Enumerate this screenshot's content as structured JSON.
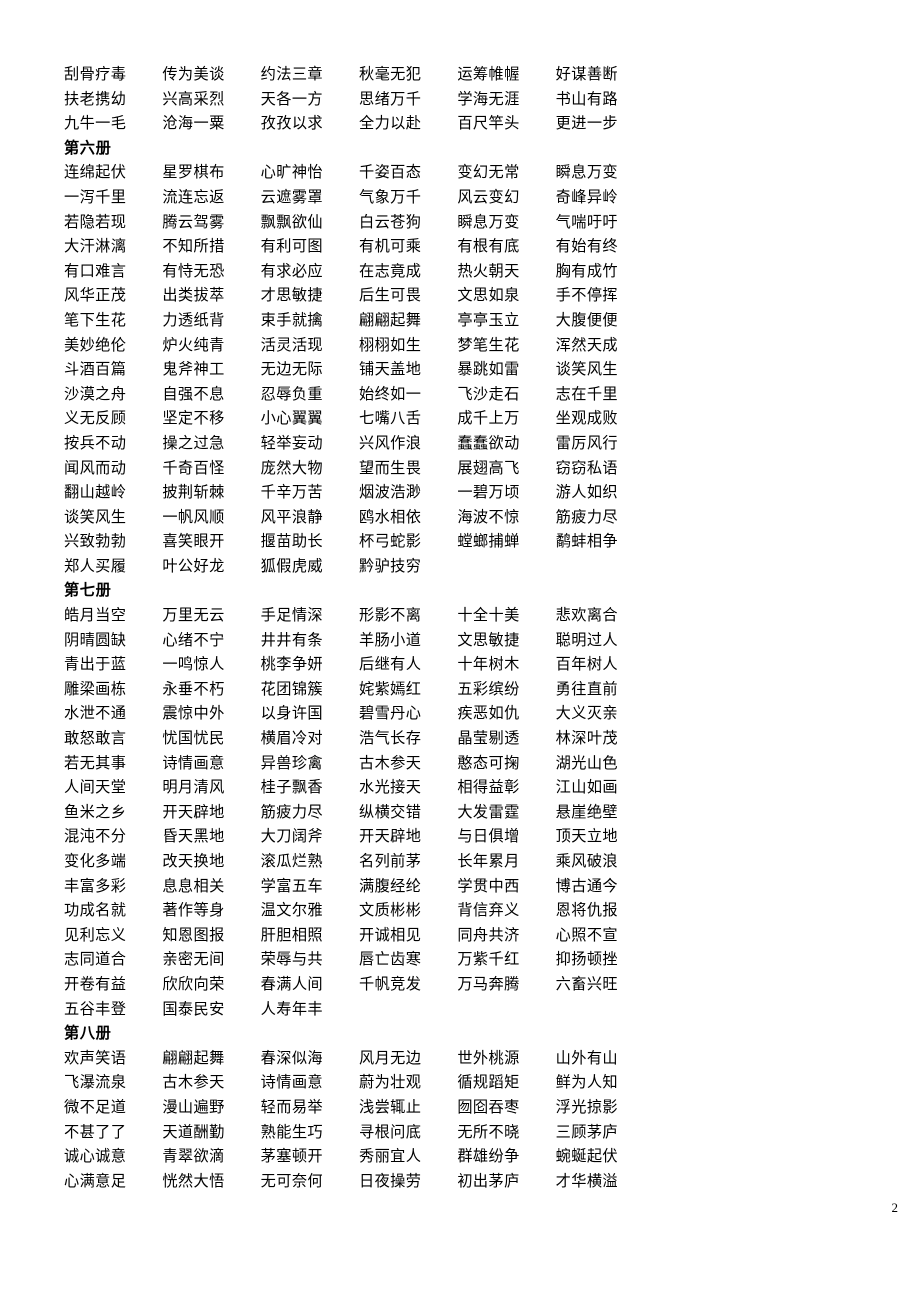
{
  "document": {
    "page_number": "2",
    "columns": 6
  },
  "rows": [
    {
      "type": "idioms",
      "cells": [
        "刮骨疗毒",
        "传为美谈",
        "约法三章",
        "秋毫无犯",
        "运筹帷幄",
        "好谋善断"
      ]
    },
    {
      "type": "idioms",
      "cells": [
        "扶老携幼",
        "兴高采烈",
        "天各一方",
        "思绪万千",
        "学海无涯",
        "书山有路"
      ]
    },
    {
      "type": "idioms",
      "cells": [
        "九牛一毛",
        "沧海一粟",
        "孜孜以求",
        "全力以赴",
        "百尺竿头",
        "更进一步"
      ]
    },
    {
      "type": "heading",
      "cells": [
        "第六册",
        "",
        "",
        "",
        "",
        ""
      ]
    },
    {
      "type": "idioms",
      "cells": [
        "连绵起伏",
        "星罗棋布",
        "心旷神怡",
        "千姿百态",
        "变幻无常",
        "瞬息万变"
      ]
    },
    {
      "type": "idioms",
      "cells": [
        "一泻千里",
        "流连忘返",
        "云遮雾罩",
        "气象万千",
        "风云变幻",
        "奇峰异岭"
      ]
    },
    {
      "type": "idioms",
      "cells": [
        "若隐若现",
        "腾云驾雾",
        "飘飘欲仙",
        "白云苍狗",
        "瞬息万变",
        "气喘吁吁"
      ]
    },
    {
      "type": "idioms",
      "cells": [
        "大汗淋漓",
        "不知所措",
        "有利可图",
        "有机可乘",
        "有根有底",
        "有始有终"
      ]
    },
    {
      "type": "idioms",
      "cells": [
        "有口难言",
        "有恃无恐",
        "有求必应",
        "在志竟成",
        "热火朝天",
        "胸有成竹"
      ]
    },
    {
      "type": "idioms",
      "cells": [
        "风华正茂",
        "出类拔萃",
        "才思敏捷",
        "后生可畏",
        "文思如泉",
        "手不停挥"
      ]
    },
    {
      "type": "idioms",
      "cells": [
        "笔下生花",
        "力透纸背",
        "束手就擒",
        "翩翩起舞",
        "亭亭玉立",
        "大腹便便"
      ]
    },
    {
      "type": "idioms",
      "cells": [
        "美妙绝伦",
        "炉火纯青",
        "活灵活现",
        "栩栩如生",
        "梦笔生花",
        "浑然天成"
      ]
    },
    {
      "type": "idioms",
      "cells": [
        "斗酒百篇",
        "鬼斧神工",
        "无边无际",
        "铺天盖地",
        "暴跳如雷",
        "谈笑风生"
      ]
    },
    {
      "type": "idioms",
      "cells": [
        "沙漠之舟",
        "自强不息",
        "忍辱负重",
        "始终如一",
        "飞沙走石",
        "志在千里"
      ]
    },
    {
      "type": "idioms",
      "cells": [
        "义无反顾",
        "坚定不移",
        "小心翼翼",
        "七嘴八舌",
        "成千上万",
        "坐观成败"
      ]
    },
    {
      "type": "idioms",
      "cells": [
        "按兵不动",
        "操之过急",
        "轻举妄动",
        "兴风作浪",
        "蠢蠢欲动",
        "雷厉风行"
      ]
    },
    {
      "type": "idioms",
      "cells": [
        "闻风而动",
        "千奇百怪",
        "庞然大物",
        "望而生畏",
        "展翅高飞",
        "窃窃私语"
      ]
    },
    {
      "type": "idioms",
      "cells": [
        "翻山越岭",
        "披荆斩棘",
        "千辛万苦",
        "烟波浩渺",
        "一碧万顷",
        "游人如织"
      ]
    },
    {
      "type": "idioms",
      "cells": [
        "谈笑风生",
        "一帆风顺",
        "风平浪静",
        "鸥水相依",
        "海波不惊",
        "筋疲力尽"
      ]
    },
    {
      "type": "idioms",
      "cells": [
        "兴致勃勃",
        "喜笑眼开",
        "揠苗助长",
        "杯弓蛇影",
        "螳螂捕蝉",
        "鹬蚌相争"
      ]
    },
    {
      "type": "idioms",
      "cells": [
        "郑人买履",
        "叶公好龙",
        "狐假虎威",
        "黔驴技穷",
        "",
        ""
      ]
    },
    {
      "type": "heading",
      "cells": [
        "第七册",
        "",
        "",
        "",
        "",
        ""
      ]
    },
    {
      "type": "idioms",
      "cells": [
        "皓月当空",
        "万里无云",
        "手足情深",
        "形影不离",
        "十全十美",
        "悲欢离合"
      ]
    },
    {
      "type": "idioms",
      "cells": [
        "阴晴圆缺",
        "心绪不宁",
        "井井有条",
        "羊肠小道",
        "文思敏捷",
        "聪明过人"
      ]
    },
    {
      "type": "idioms",
      "cells": [
        "青出于蓝",
        "一鸣惊人",
        "桃李争妍",
        "后继有人",
        "十年树木",
        "百年树人"
      ]
    },
    {
      "type": "idioms",
      "cells": [
        "雕梁画栋",
        "永垂不朽",
        "花团锦簇",
        "姹紫嫣红",
        "五彩缤纷",
        "勇往直前"
      ]
    },
    {
      "type": "idioms",
      "cells": [
        "水泄不通",
        "震惊中外",
        "以身许国",
        "碧雪丹心",
        "疾恶如仇",
        "大义灭亲"
      ]
    },
    {
      "type": "idioms",
      "cells": [
        "敢怒敢言",
        "忧国忧民",
        "横眉冷对",
        "浩气长存",
        "晶莹剔透",
        "林深叶茂"
      ]
    },
    {
      "type": "idioms",
      "cells": [
        "若无其事",
        "诗情画意",
        "异兽珍禽",
        "古木参天",
        "憨态可掬",
        "湖光山色"
      ]
    },
    {
      "type": "idioms",
      "cells": [
        "人间天堂",
        "明月清风",
        "桂子飘香",
        "水光接天",
        "相得益彰",
        "江山如画"
      ]
    },
    {
      "type": "idioms",
      "cells": [
        "鱼米之乡",
        "开天辟地",
        "筋疲力尽",
        "纵横交错",
        "大发雷霆",
        "悬崖绝壁"
      ]
    },
    {
      "type": "idioms",
      "cells": [
        "混沌不分",
        "昏天黑地",
        "大刀阔斧",
        "开天辟地",
        "与日俱增",
        "顶天立地"
      ]
    },
    {
      "type": "idioms",
      "cells": [
        "变化多端",
        "改天换地",
        "滚瓜烂熟",
        "名列前茅",
        "长年累月",
        "乘风破浪"
      ]
    },
    {
      "type": "idioms",
      "cells": [
        "丰富多彩",
        "息息相关",
        "学富五车",
        "满腹经纶",
        "学贯中西",
        "博古通今"
      ]
    },
    {
      "type": "idioms",
      "cells": [
        "功成名就",
        "著作等身",
        "温文尔雅",
        "文质彬彬",
        "背信弃义",
        "恩将仇报"
      ]
    },
    {
      "type": "idioms",
      "cells": [
        "见利忘义",
        "知恩图报",
        "肝胆相照",
        "开诚相见",
        "同舟共济",
        "心照不宣"
      ]
    },
    {
      "type": "idioms",
      "cells": [
        "志同道合",
        "亲密无间",
        "荣辱与共",
        "唇亡齿寒",
        "万紫千红",
        "抑扬顿挫"
      ]
    },
    {
      "type": "idioms",
      "cells": [
        "开卷有益",
        "欣欣向荣",
        "春满人间",
        "千帆竞发",
        "万马奔腾",
        "六畜兴旺"
      ]
    },
    {
      "type": "idioms",
      "cells": [
        "五谷丰登",
        "国泰民安",
        "人寿年丰",
        "",
        "",
        ""
      ]
    },
    {
      "type": "heading",
      "cells": [
        "第八册",
        "",
        "",
        "",
        "",
        ""
      ]
    },
    {
      "type": "idioms",
      "cells": [
        "欢声笑语",
        "翩翩起舞",
        "春深似海",
        "风月无边",
        "世外桃源",
        "山外有山"
      ]
    },
    {
      "type": "idioms",
      "cells": [
        "飞瀑流泉",
        "古木参天",
        "诗情画意",
        "蔚为壮观",
        "循规蹈矩",
        "鲜为人知"
      ]
    },
    {
      "type": "idioms",
      "cells": [
        "微不足道",
        "漫山遍野",
        "轻而易举",
        "浅尝辄止",
        "囫囵吞枣",
        "浮光掠影"
      ]
    },
    {
      "type": "idioms",
      "cells": [
        "不甚了了",
        "天道酬勤",
        "熟能生巧",
        "寻根问底",
        "无所不晓",
        "三顾茅庐"
      ]
    },
    {
      "type": "idioms",
      "cells": [
        "诚心诚意",
        "青翠欲滴",
        "茅塞顿开",
        "秀丽宜人",
        "群雄纷争",
        "蜿蜒起伏"
      ]
    },
    {
      "type": "idioms",
      "cells": [
        "心满意足",
        "恍然大悟",
        "无可奈何",
        "日夜操劳",
        "初出茅庐",
        "才华横溢"
      ]
    }
  ]
}
